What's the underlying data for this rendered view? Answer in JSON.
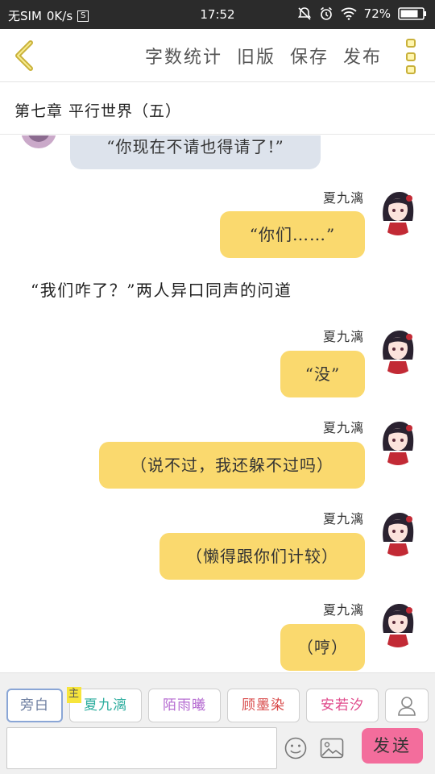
{
  "status_bar": {
    "carrier": "无SIM",
    "speed": "0K/s",
    "s_badge": "S",
    "time": "17:52",
    "battery": "72%"
  },
  "toolbar": {
    "actions": [
      "字数统计",
      "旧版",
      "保存",
      "发布"
    ]
  },
  "chapter": {
    "title": "第七章 平行世界（五）"
  },
  "messages": [
    {
      "kind": "left_partial",
      "text": "“你现在不请也得请了!”"
    },
    {
      "kind": "right",
      "speaker": "夏九漓",
      "text": "“你们……”"
    },
    {
      "kind": "narration",
      "text": "“我们咋了？”两人异口同声的问道"
    },
    {
      "kind": "right",
      "speaker": "夏九漓",
      "text": "“没”"
    },
    {
      "kind": "right",
      "speaker": "夏九漓",
      "text": "（说不过，我还躲不过吗）"
    },
    {
      "kind": "right",
      "speaker": "夏九漓",
      "text": "（懒得跟你们计较）"
    },
    {
      "kind": "right",
      "speaker": "夏九漓",
      "text": "（哼）"
    }
  ],
  "roles": [
    {
      "label": "旁白",
      "tag": ""
    },
    {
      "label": "夏九漓",
      "tag": "主"
    },
    {
      "label": "陌雨曦",
      "tag": ""
    },
    {
      "label": "顾墨染",
      "tag": ""
    },
    {
      "label": "安若汐",
      "tag": ""
    }
  ],
  "composer": {
    "input_value": "",
    "send_label": "发送"
  },
  "colors": {
    "bubble_yellow": "#fad96e",
    "bubble_gray": "#dde3ec",
    "send_pink": "#f36d9c",
    "accent_gold": "#c9b13a"
  },
  "icons": {
    "back": "chevron-left-icon",
    "more": "more-vertical-icon",
    "emoji": "smiley-icon",
    "image": "image-icon",
    "person": "person-icon"
  }
}
